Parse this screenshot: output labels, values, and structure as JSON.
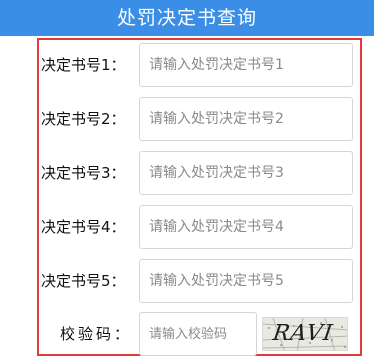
{
  "header": {
    "title": "处罚决定书查询"
  },
  "form": {
    "fields": [
      {
        "label": "决定书号1：",
        "placeholder": "请输入处罚决定书号1",
        "value": ""
      },
      {
        "label": "决定书号2：",
        "placeholder": "请输入处罚决定书号2",
        "value": ""
      },
      {
        "label": "决定书号3：",
        "placeholder": "请输入处罚决定书号3",
        "value": ""
      },
      {
        "label": "决定书号4：",
        "placeholder": "请输入处罚决定书号4",
        "value": ""
      },
      {
        "label": "决定书号5：",
        "placeholder": "请输入处罚决定书号5",
        "value": ""
      }
    ],
    "captcha": {
      "label": "校验码：",
      "placeholder": "请输入校验码",
      "value": "",
      "image_text": "RAVI"
    }
  },
  "colors": {
    "header_bg": "#3a8ee6",
    "frame_border": "#e23b3b",
    "input_border": "#d6d6d6"
  }
}
